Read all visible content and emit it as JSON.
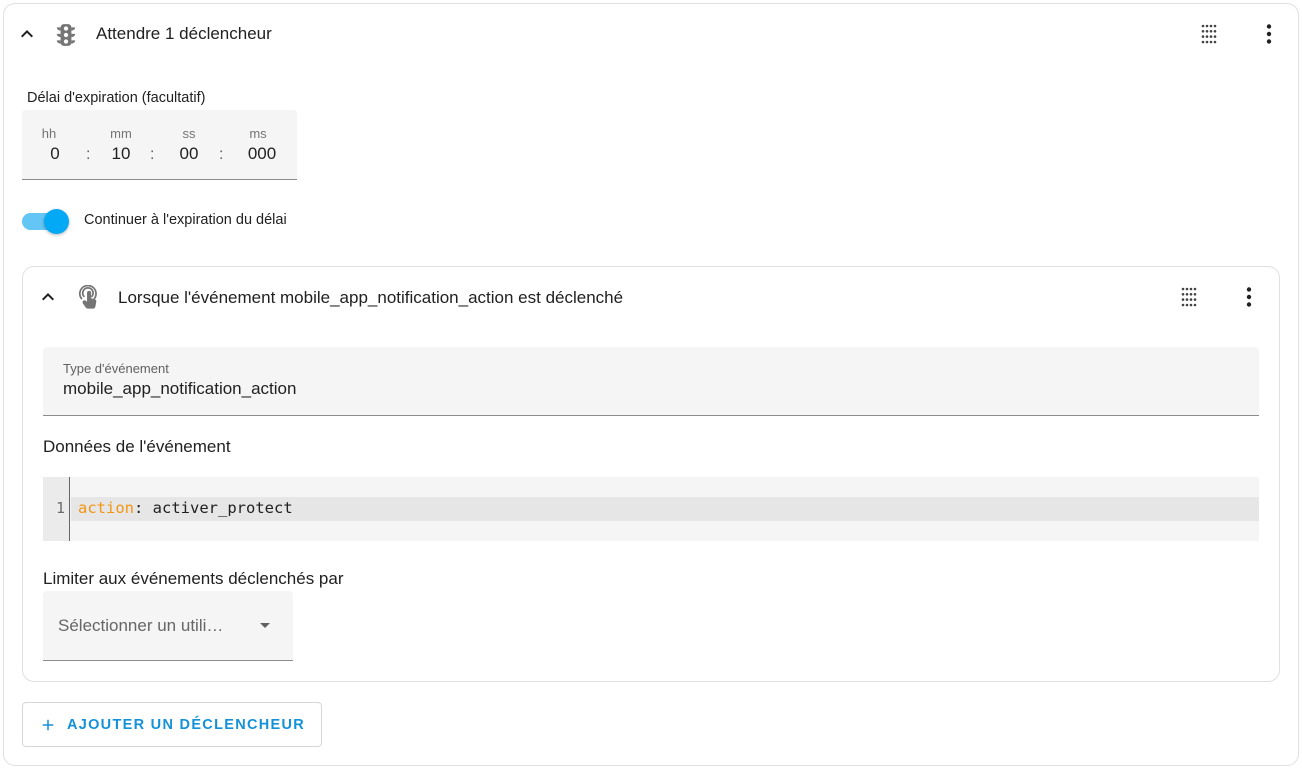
{
  "header": {
    "title": "Attendre 1 déclencheur",
    "leading_icon": "traffic-light-icon",
    "drag_icon": "drag-grid-icon",
    "menu_icon": "more-vertical-icon"
  },
  "timeout": {
    "label": "Délai d'expiration (facultatif)",
    "units": [
      "hh",
      "mm",
      "ss",
      "ms"
    ],
    "values": [
      "0",
      "10",
      "00",
      "000"
    ],
    "separator": ":"
  },
  "continue_on_timeout": {
    "label": "Continuer à l'expiration du délai",
    "enabled": true
  },
  "trigger": {
    "title": "Lorsque l'événement mobile_app_notification_action est déclenché",
    "icon": "gesture-tap-icon",
    "event_type": {
      "label": "Type d'événement",
      "value": "mobile_app_notification_action"
    },
    "event_data": {
      "label": "Données de l'événement",
      "line_number": "1",
      "key": "action",
      "separator": ": ",
      "value": "activer_protect"
    },
    "limit": {
      "label": "Limiter aux événements déclenchés par",
      "placeholder": "Sélectionner un utili…"
    }
  },
  "add_trigger_button": {
    "label": "AJOUTER UN DÉCLENCHEUR",
    "icon": "plus-icon"
  },
  "colors": {
    "accent": "#03a9f4",
    "accent_text": "#1591d8",
    "yaml_key": "#f29613",
    "field_bg": "#f5f5f5"
  }
}
